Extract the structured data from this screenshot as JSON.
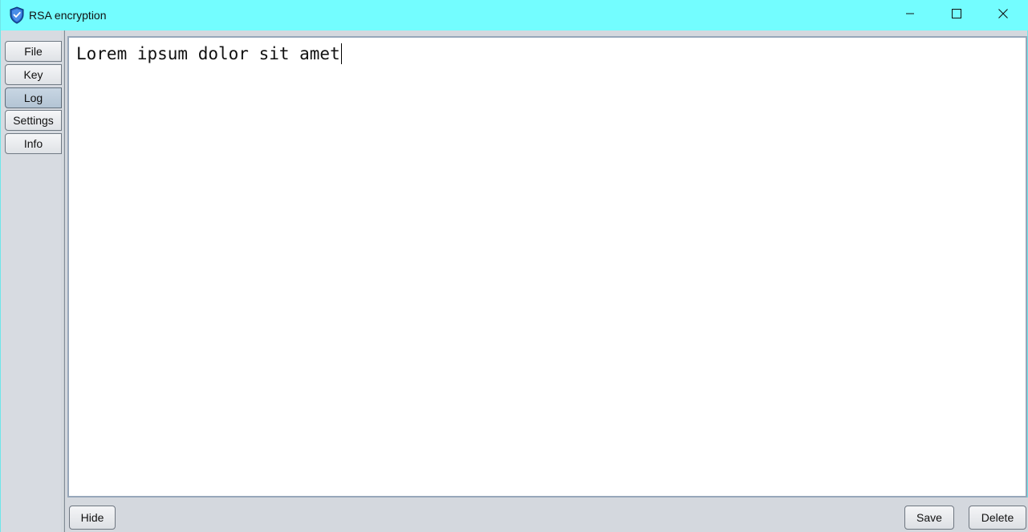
{
  "window": {
    "title": "RSA encryption",
    "icon": "shield-check-icon",
    "controls": [
      "minimize-icon",
      "maximize-icon",
      "close-icon"
    ],
    "titlebar_color": "#73fdff"
  },
  "sidebar": {
    "items": [
      {
        "label": "File",
        "active": false
      },
      {
        "label": "Key",
        "active": false
      },
      {
        "label": "Log",
        "active": true
      },
      {
        "label": "Settings",
        "active": false
      },
      {
        "label": "Info",
        "active": false
      }
    ]
  },
  "editor": {
    "text": "Lorem ipsum dolor sit amet"
  },
  "footer": {
    "hide_label": "Hide",
    "save_label": "Save",
    "delete_label": "Delete"
  }
}
